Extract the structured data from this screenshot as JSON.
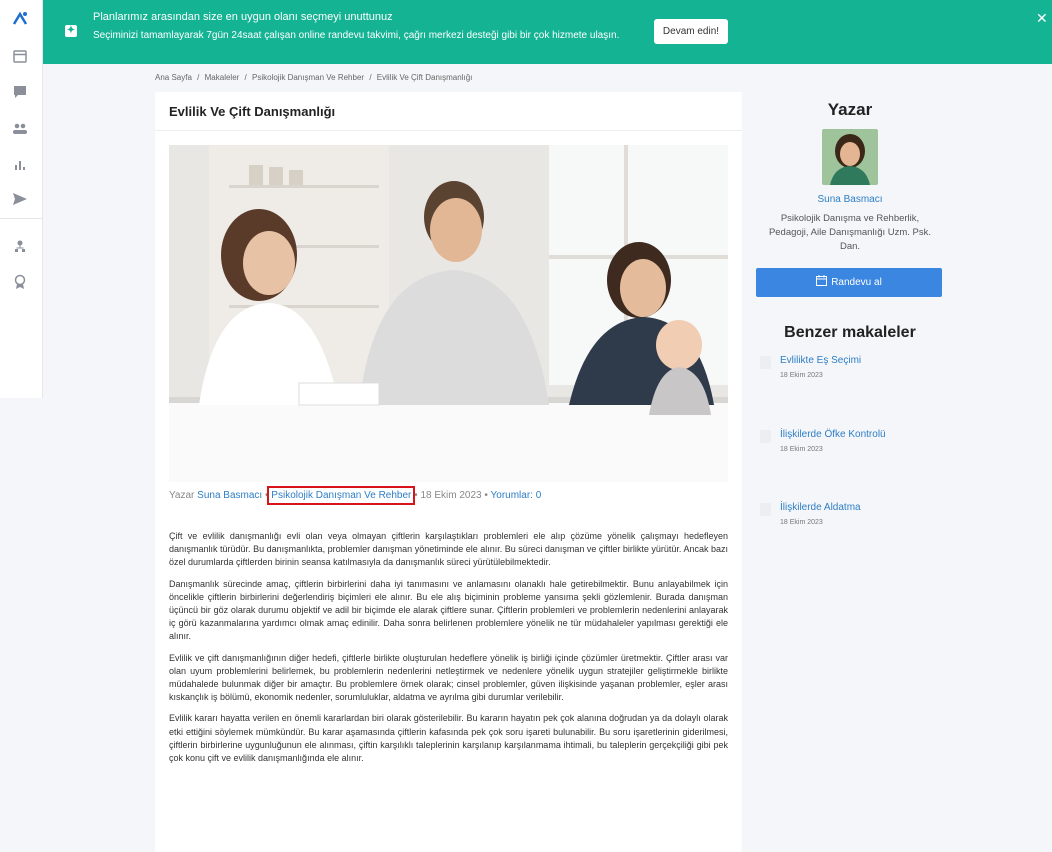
{
  "banner": {
    "title": "Planlarımız arasından size en uygun olanı seçmeyi unuttunuz",
    "subtitle": "Seçiminizi tamamlayarak 7gün 24saat çalışan online randevu takvimi, çağrı merkezi desteği gibi bir çok hizmete ulaşın.",
    "cta": "Devam edin!",
    "close": "✕"
  },
  "breadcrumb": [
    "Ana Sayfa",
    "/",
    "Makaleler",
    "/",
    "Psikolojik Danışman Ve Rehber",
    "/",
    "Evlilik Ve Çift Danışmanlığı"
  ],
  "article": {
    "title": "Evlilik Ve Çift Danışmanlığı",
    "meta": {
      "prefix": "Yazar",
      "author": "Suna Basmacı",
      "sep1": "•",
      "category": "Psikolojik Danışman Ve Rehber",
      "sep2": "•",
      "date": "18 Ekim 2023",
      "sep3": "•",
      "comments": "Yorumlar: 0"
    },
    "paragraphs": [
      "Çift ve evlilik danışmanlığı evli olan veya olmayan çiftlerin karşılaştıkları problemleri ele alıp çözüme yönelik çalışmayı hedefleyen danışmanlık türüdür. Bu danışmanlıkta, problemler danışman yönetiminde ele alınır. Bu süreci danışman ve çiftler birlikte yürütür. Ancak bazı özel durumlarda çiftlerden birinin seansa katılmasıyla da danışmanlık süreci yürütülebilmektedir.",
      "Danışmanlık sürecinde amaç, çiftlerin birbirlerini daha iyi tanımasını ve anlamasını olanaklı hale getirebilmektir. Bunu anlayabilmek için öncelikle çiftlerin birbirlerini değerlendiriş biçimleri ele alınır. Bu ele alış biçiminin probleme yansıma şekli gözlemlenir. Burada danışman üçüncü bir göz olarak durumu objektif ve adil bir biçimde ele alarak çiftlere sunar. Çiftlerin problemleri ve problemlerin nedenlerini anlayarak iç görü kazanmalarına yardımcı olmak amaç edinilir. Daha sonra belirlenen problemlere yönelik ne tür müdahaleler yapılması gerektiği ele alınır.",
      "Evlilik ve çift danışmanlığının diğer hedefi, çiftlerle birlikte oluşturulan hedeflere yönelik iş birliği içinde çözümler üretmektir. Çiftler arası var olan uyum problemlerini belirlemek, bu problemlerin nedenlerini netleştirmek ve nedenlere yönelik uygun stratejiler geliştirmekle birlikte müdahalede bulunmak diğer bir amaçtır. Bu problemlere örnek olarak; cinsel problemler, güven ilişkisinde yaşanan problemler, eşler arası kıskançlık iş bölümü, ekonomik nedenler, sorumluluklar, aldatma ve ayrılma gibi durumlar verilebilir.",
      "Evlilik kararı hayatta verilen en önemli kararlardan biri olarak gösterilebilir. Bu kararın hayatın pek çok alanına doğrudan ya da dolaylı olarak etki ettiğini söylemek mümkündür. Bu karar aşamasında çiftlerin kafasında pek çok soru işareti bulunabilir. Bu soru işaretlerinin giderilmesi, çiftlerin birbirlerine uygunluğunun ele alınması, çiftin karşılıklı taleplerinin karşılanıp karşılanmama ihtimali, bu taleplerin gerçekçiliği gibi pek çok konu çift ve evlilik danışmanlığında ele alınır."
    ]
  },
  "author_panel": {
    "heading": "Yazar",
    "name": "Suna Basmacı",
    "description": "Psikolojik Danışma ve Rehberlik, Pedagoji, Aile Danışmanlığı Uzm. Psk. Dan.",
    "appointment": "Randevu al"
  },
  "similar": {
    "heading": "Benzer makaleler",
    "items": [
      {
        "title": "Evlilikte Eş Seçimi",
        "date": "18 Ekim 2023"
      },
      {
        "title": "İlişkilerde Öfke Kontrolü",
        "date": "18 Ekim 2023"
      },
      {
        "title": "İlişkilerde Aldatma",
        "date": "18 Ekim 2023"
      }
    ]
  },
  "sidebar_icons": [
    "logo-icon",
    "calendar-icon",
    "chat-icon",
    "users-icon",
    "stats-icon",
    "send-icon",
    "org-icon",
    "badge-icon"
  ]
}
